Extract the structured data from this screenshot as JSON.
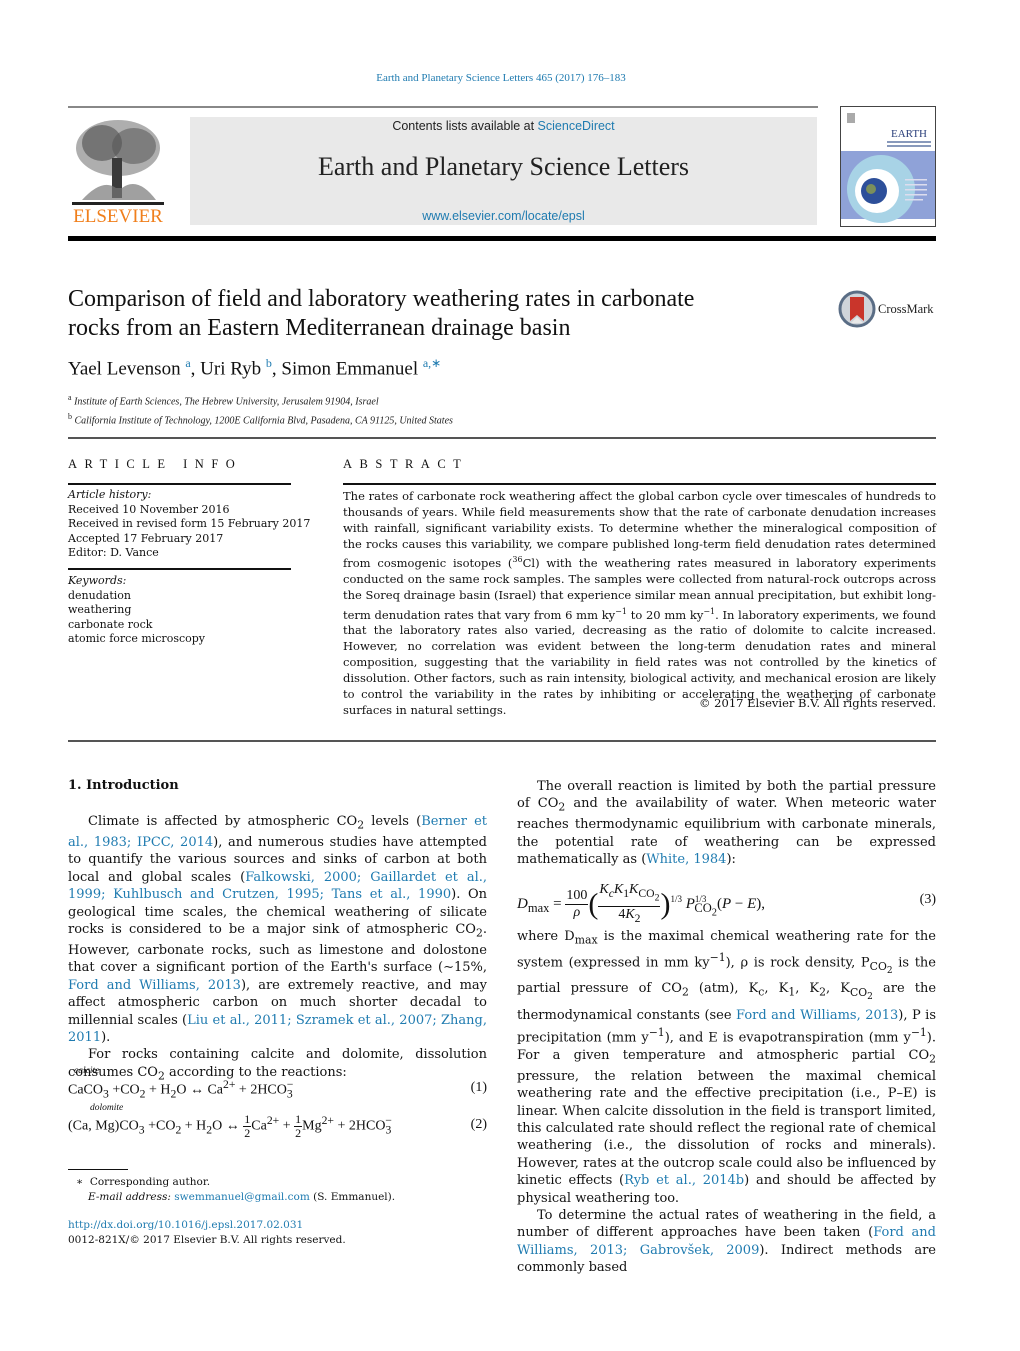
{
  "header": {
    "journal_ref": "Earth and Planetary Science Letters 465 (2017) 176–183",
    "contents_prefix": "Contents lists available at ",
    "contents_link": "ScienceDirect",
    "journal_title": "Earth and Planetary Science Letters",
    "journal_url": "www.elsevier.com/locate/epsl",
    "publisher": "ELSEVIER",
    "cover_title": "EARTH",
    "cover_subtitle": "& PLANETARY SCIENCE LETTERS"
  },
  "article": {
    "title_line1": "Comparison of field and laboratory weathering rates in carbonate",
    "title_line2": "rocks from an Eastern Mediterranean drainage basin",
    "crossmark_label": "CrossMark",
    "authors": [
      {
        "name": "Yael Levenson",
        "aff": "a"
      },
      {
        "name": "Uri Ryb",
        "aff": "b"
      },
      {
        "name": "Simon Emmanuel",
        "aff": "a,∗"
      }
    ],
    "affiliations": [
      {
        "key": "a",
        "text": "Institute of Earth Sciences, The Hebrew University, Jerusalem 91904, Israel"
      },
      {
        "key": "b",
        "text": "California Institute of Technology, 1200E California Blvd, Pasadena, CA 91125, United States"
      }
    ]
  },
  "article_info": {
    "heading": "ARTICLE INFO",
    "history_label": "Article history:",
    "history": [
      "Received 10 November 2016",
      "Received in revised form 15 February 2017",
      "Accepted 17 February 2017",
      "Editor: D. Vance"
    ],
    "keywords_label": "Keywords:",
    "keywords": [
      "denudation",
      "weathering",
      "carbonate rock",
      "atomic force microscopy"
    ]
  },
  "abstract": {
    "heading": "ABSTRACT",
    "part1": "The rates of carbonate rock weathering affect the global carbon cycle over timescales of hundreds to thousands of years. While field measurements show that the rate of carbonate denudation increases with rainfall, significant variability exists. To determine whether the mineralogical composition of the rocks causes this variability, we compare published long-term field denudation rates determined from cosmogenic isotopes (",
    "isotope_mass": "36",
    "isotope_symbol": "Cl",
    "part2": ") with the weathering rates measured in laboratory experiments conducted on the same rock samples. The samples were collected from natural-rock outcrops across the Soreq drainage basin (Israel) that experience similar mean annual precipitation, but exhibit long-term denudation rates that vary from 6 mm ky",
    "exp": "−1",
    "part3": " to 20 mm ky",
    "part4": ". In laboratory experiments, we found that the laboratory rates also varied, decreasing as the ratio of dolomite to calcite increased. However, no correlation was evident between the long-term denudation rates and mineral composition, suggesting that the variability in field rates was not controlled by the kinetics of dissolution. Other factors, such as rain intensity, biological activity, and mechanical erosion are likely to control the variability in the rates by inhibiting or accelerating the weathering of carbonate surfaces in natural settings.",
    "copyright": "© 2017 Elsevier B.V. All rights reserved."
  },
  "intro": {
    "heading": "1.  Introduction",
    "p1": {
      "t1": "Climate is affected by atmospheric CO",
      "t2": " levels (",
      "l1": "Berner et al., 1983; IPCC, 2014",
      "t3": "), and numerous studies have attempted to quantify the various sources and sinks of carbon at both local and global scales (",
      "l2": "Falkowski, 2000; Gaillardet et al., 1999; Kuhlbusch and Crutzen, 1995; Tans et al., 1990",
      "t4": "). On geological time scales, the chemical weathering of silicate rocks is considered to be a major sink of atmospheric CO",
      "t5": ". However, carbonate rocks, such as limestone and dolostone that cover a significant portion of the Earth's surface (∼15%, ",
      "l3": "Ford and Williams, 2013",
      "t6": "), are extremely reactive, and may affect atmospheric carbon on much shorter decadal to millennial scales (",
      "l4": "Liu et al., 2011; Szramek et al., 2007; Zhang, 2011",
      "t7": ")."
    },
    "p2": {
      "t1": "For rocks containing calcite and dolomite, dissolution consumes CO",
      "t2": " according to the reactions:"
    },
    "eq1": {
      "over": "calcite",
      "num": "(1)"
    },
    "eq2": {
      "over": "dolomite",
      "num": "(2)"
    },
    "p3": {
      "t1": "The overall reaction is limited by both the partial pressure of CO",
      "t2": " and the availability of water. When meteoric water reaches thermodynamic equilibrium with carbonate minerals, the potential rate of weathering can be expressed mathematically as (",
      "l1": "White, 1984",
      "t3": "):"
    },
    "eq3": {
      "num": "(3)"
    },
    "p4": {
      "t1": "where D",
      "t1sub": "max",
      "t2": " is the maximal chemical weathering rate for the system (expressed in mm ky",
      "t3": "), ρ is rock density, P",
      "t4": " is the partial pressure of CO",
      "t5": " (atm), K",
      "t6": " are the thermodynamical constants (see ",
      "l1": "Ford and Williams, 2013",
      "t7": "), P is precipitation (mm y",
      "t8": "), and E is evapotranspiration (mm y",
      "t9": "). For a given temperature and atmospheric partial CO",
      "t10": " pressure, the relation between the maximal chemical weathering rate and the effective precipitation (i.e., P–E) is linear. When calcite dissolution in the field is transport limited, this calculated rate should reflect the regional rate of chemical weathering (i.e., the dissolution of rocks and minerals). However, rates at the outcrop scale could also be influenced by kinetic effects (",
      "l2": "Ryb et al., 2014b",
      "t11": ") and should be affected by physical weathering too."
    },
    "p5": {
      "t1": "To determine the actual rates of weathering in the field, a number of different approaches have been taken (",
      "l1": "Ford and Williams, 2013; Gabrovšek, 2009",
      "t2": "). Indirect methods are commonly based"
    }
  },
  "footnote": {
    "star": "∗",
    "corresponding": "Corresponding author.",
    "email_label": "E-mail address:",
    "email": "swemmanuel@gmail.com",
    "email_suffix": " (S. Emmanuel).",
    "doi": "http://dx.doi.org/10.1016/j.epsl.2017.02.031",
    "issn": "0012-821X/© 2017 Elsevier B.V. All rights reserved."
  }
}
